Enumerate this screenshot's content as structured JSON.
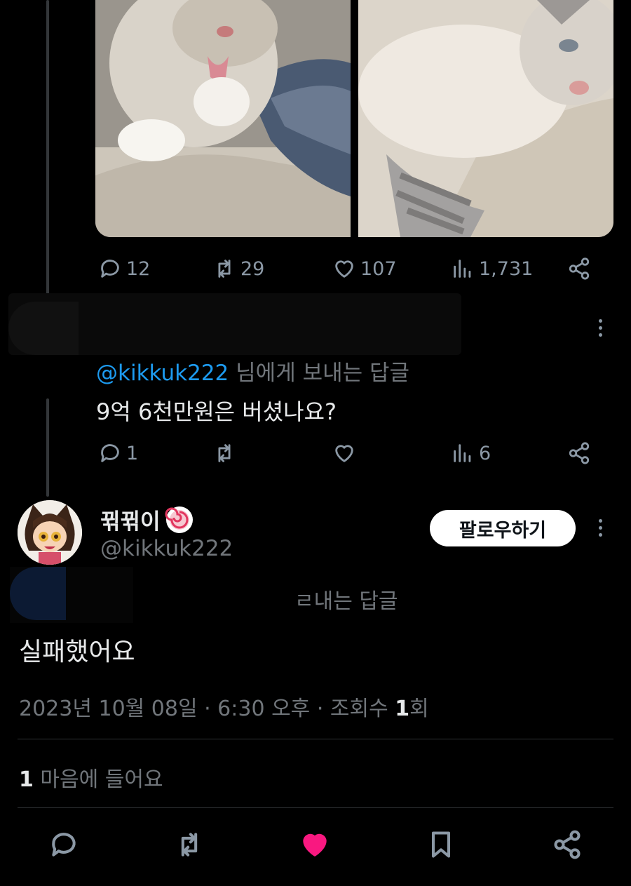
{
  "first_tweet": {
    "actions": {
      "replies": "12",
      "retweets": "29",
      "likes": "107",
      "views": "1,731"
    }
  },
  "reply_tweet": {
    "replying_to_handle": "@kikkuk222",
    "replying_to_suffix": "님에게 보내는 답글",
    "text": "9억 6천만원은 버셨나요?",
    "actions": {
      "replies": "1",
      "retweets": "",
      "likes": "",
      "views": "6"
    }
  },
  "main_tweet": {
    "display_name": "뀎뀎이",
    "handle": "@kikkuk222",
    "follow_label": "팔로우하기",
    "replying_partial": "ㄹ내는 답글",
    "text": "실패했어요",
    "timestamp": "2023년 10월 08일 · 6:30 오후 · 조회수 ",
    "view_count": "1",
    "view_suffix": "회",
    "likes_count": "1",
    "likes_label": " 마음에 들어요"
  },
  "colors": {
    "background": "#000000",
    "text_primary": "#e7e9ea",
    "text_secondary": "#71767b",
    "link": "#1d9bf0",
    "like_active": "#f91880",
    "divider": "#2f3336"
  },
  "icons": [
    "reply-icon",
    "retweet-icon",
    "like-icon",
    "views-icon",
    "share-icon",
    "bookmark-icon",
    "more-icon",
    "verified-badge-icon"
  ]
}
